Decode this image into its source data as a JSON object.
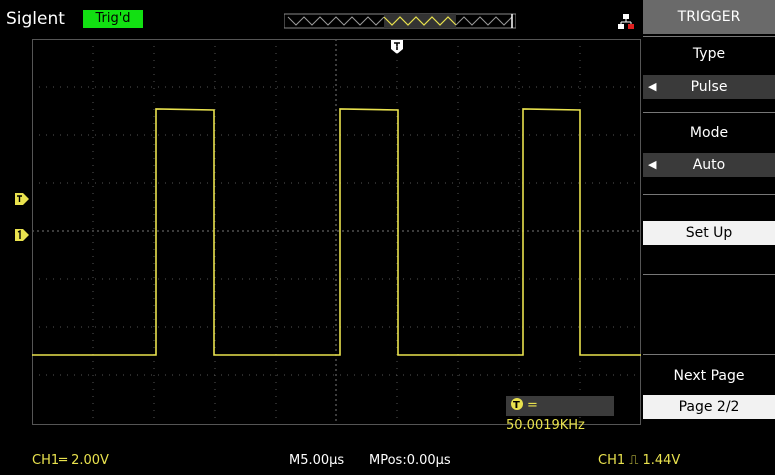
{
  "header": {
    "brand": "Siglent",
    "trigger_status": "Trig'd"
  },
  "menu": {
    "title": "TRIGGER",
    "type_label": "Type",
    "type_value": "Pulse",
    "mode_label": "Mode",
    "mode_value": "Auto",
    "setup_label": "Set Up",
    "next_page_label": "Next Page",
    "page_value": "Page 2/2"
  },
  "screen": {
    "frequency_readout": "= 50.0019KHz"
  },
  "status": {
    "ch1_scale": "CH1═ 2.00V",
    "timebase": "M5.00µs",
    "mpos": "MPos:0.00µs",
    "trigger_readout": "CH1 ⎍ 1.44V"
  },
  "colors": {
    "trace": "#e9e24e",
    "trig_status_bg": "#12e012",
    "menu_title_bg": "#6a6a6a"
  }
}
